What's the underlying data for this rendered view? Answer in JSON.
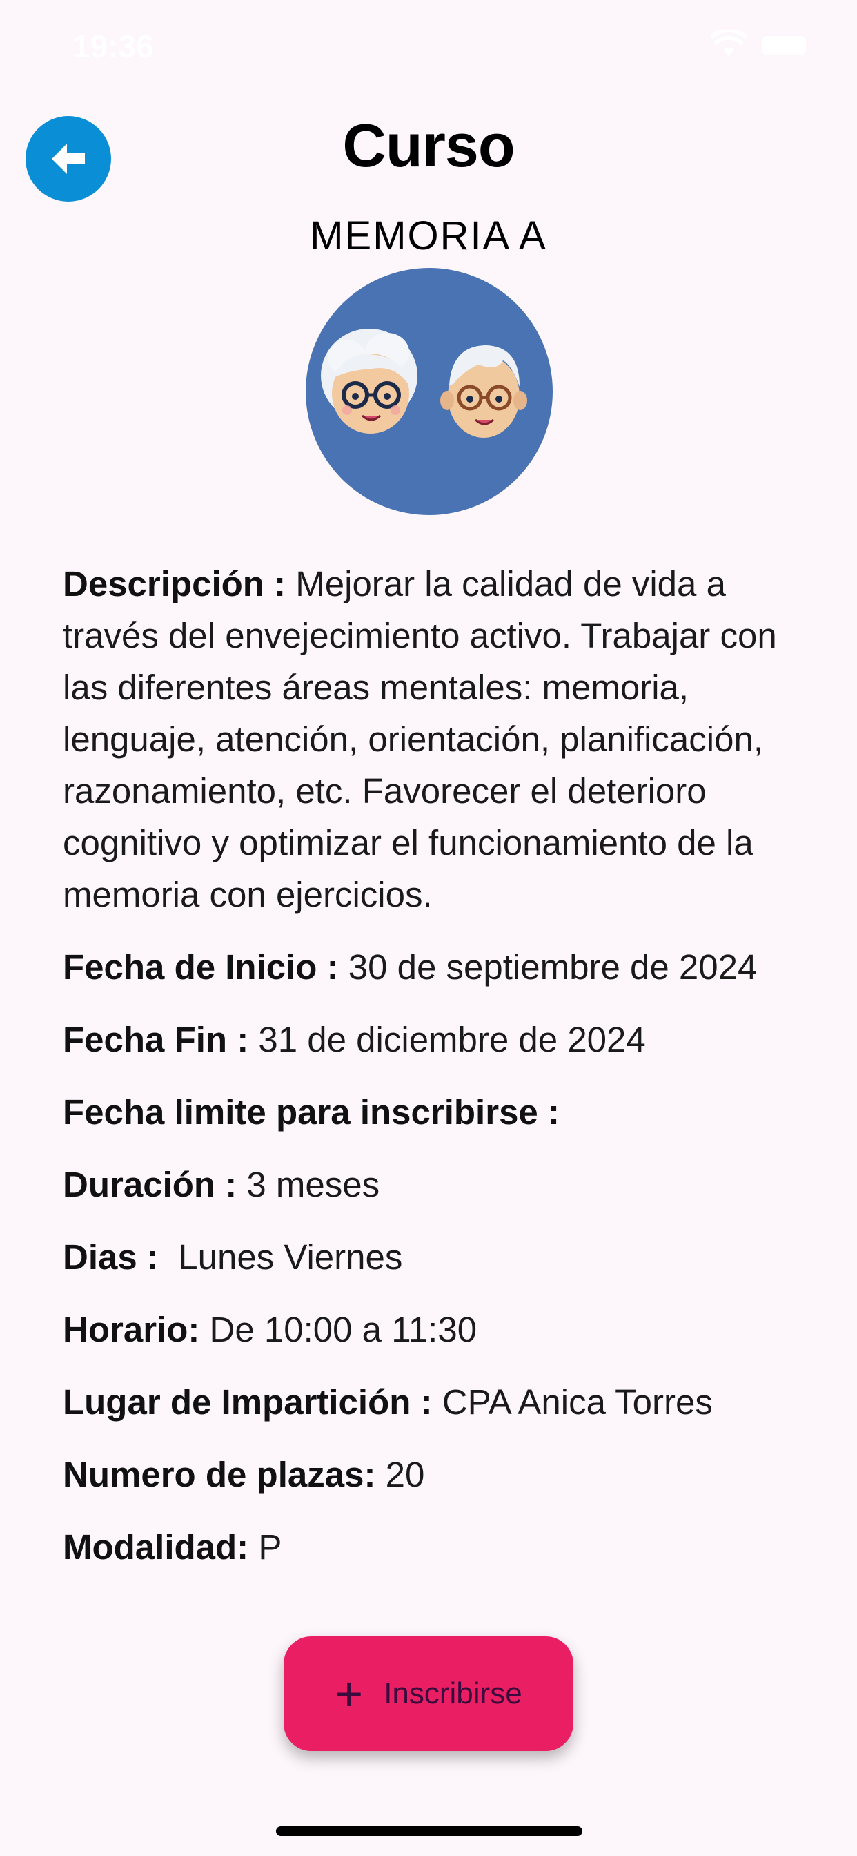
{
  "status_bar": {
    "time": "19:36"
  },
  "header": {
    "title": "Curso",
    "back_icon": "arrow-left-icon"
  },
  "course": {
    "name": "MEMORIA A",
    "avatar_icon": "elderly-couple-icon"
  },
  "details": {
    "descripcion": {
      "label": "Descripción :",
      "value": " Mejorar la calidad de vida a través del envejecimiento activo. Trabajar con las diferentes áreas mentales: memoria, lenguaje, atención, orientación, planificación, razonamiento, etc. Favorecer el deterioro cognitivo y optimizar el funcionamiento de la memoria con ejercicios."
    },
    "fecha_inicio": {
      "label": "Fecha de Inicio :",
      "value": " 30 de septiembre de 2024"
    },
    "fecha_fin": {
      "label": "Fecha Fin :",
      "value": " 31 de diciembre de 2024"
    },
    "fecha_limite": {
      "label": "Fecha limite para inscribirse :",
      "value": ""
    },
    "duracion": {
      "label": "Duración :",
      "value": " 3 meses"
    },
    "dias": {
      "label": "Dias :",
      "value": "  Lunes Viernes"
    },
    "horario": {
      "label": "Horario:",
      "value": " De 10:00 a 11:30"
    },
    "lugar": {
      "label": "Lugar de Impartición :",
      "value": " CPA Anica Torres"
    },
    "plazas": {
      "label": "Numero de plazas:",
      "value": " 20"
    },
    "modalidad": {
      "label": "Modalidad:",
      "value": " P"
    }
  },
  "fab": {
    "label": "Inscribirse",
    "icon": "plus-icon",
    "color": "#e91e63"
  },
  "colors": {
    "background": "#fdf6fb",
    "back_button": "#0a8fd6",
    "avatar_bg": "#4a73b4"
  }
}
